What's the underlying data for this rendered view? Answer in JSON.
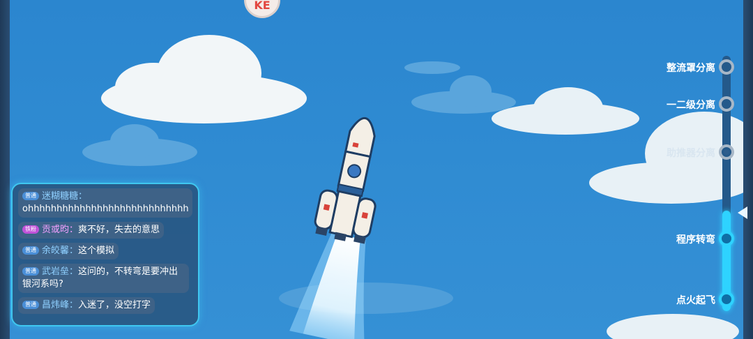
{
  "logo": {
    "text": "KE"
  },
  "chat": {
    "messages": [
      {
        "badge": "普通",
        "badge_type": "normal",
        "user": "迷糊糖糖：",
        "text": "ohhhhhhhhhhhhhhhhhhhhhhhhhhhh"
      },
      {
        "badge": "铁粉",
        "badge_type": "fan",
        "user": "贡或昀：",
        "text": "爽不好，失去的意思"
      },
      {
        "badge": "普通",
        "badge_type": "normal",
        "user": "余皎馨：",
        "text": "这个模拟"
      },
      {
        "badge": "普通",
        "badge_type": "normal",
        "user": "武岩垒：",
        "text": "这问的，不转弯是要冲出银河系吗?"
      },
      {
        "badge": "普通",
        "badge_type": "normal",
        "user": "昌炜峰：",
        "text": "入迷了，没空打字"
      }
    ]
  },
  "stages": [
    {
      "label": "整流罩分离",
      "state": "pending"
    },
    {
      "label": "一二级分离",
      "state": "pending"
    },
    {
      "label": "助推器分离",
      "state": "current"
    },
    {
      "label": "程序转弯",
      "state": "done"
    },
    {
      "label": "点火起飞",
      "state": "done"
    }
  ],
  "colors": {
    "sky": "#2f86cf",
    "accent": "#2ed3ff",
    "chat_border": "#3fc7f0"
  }
}
